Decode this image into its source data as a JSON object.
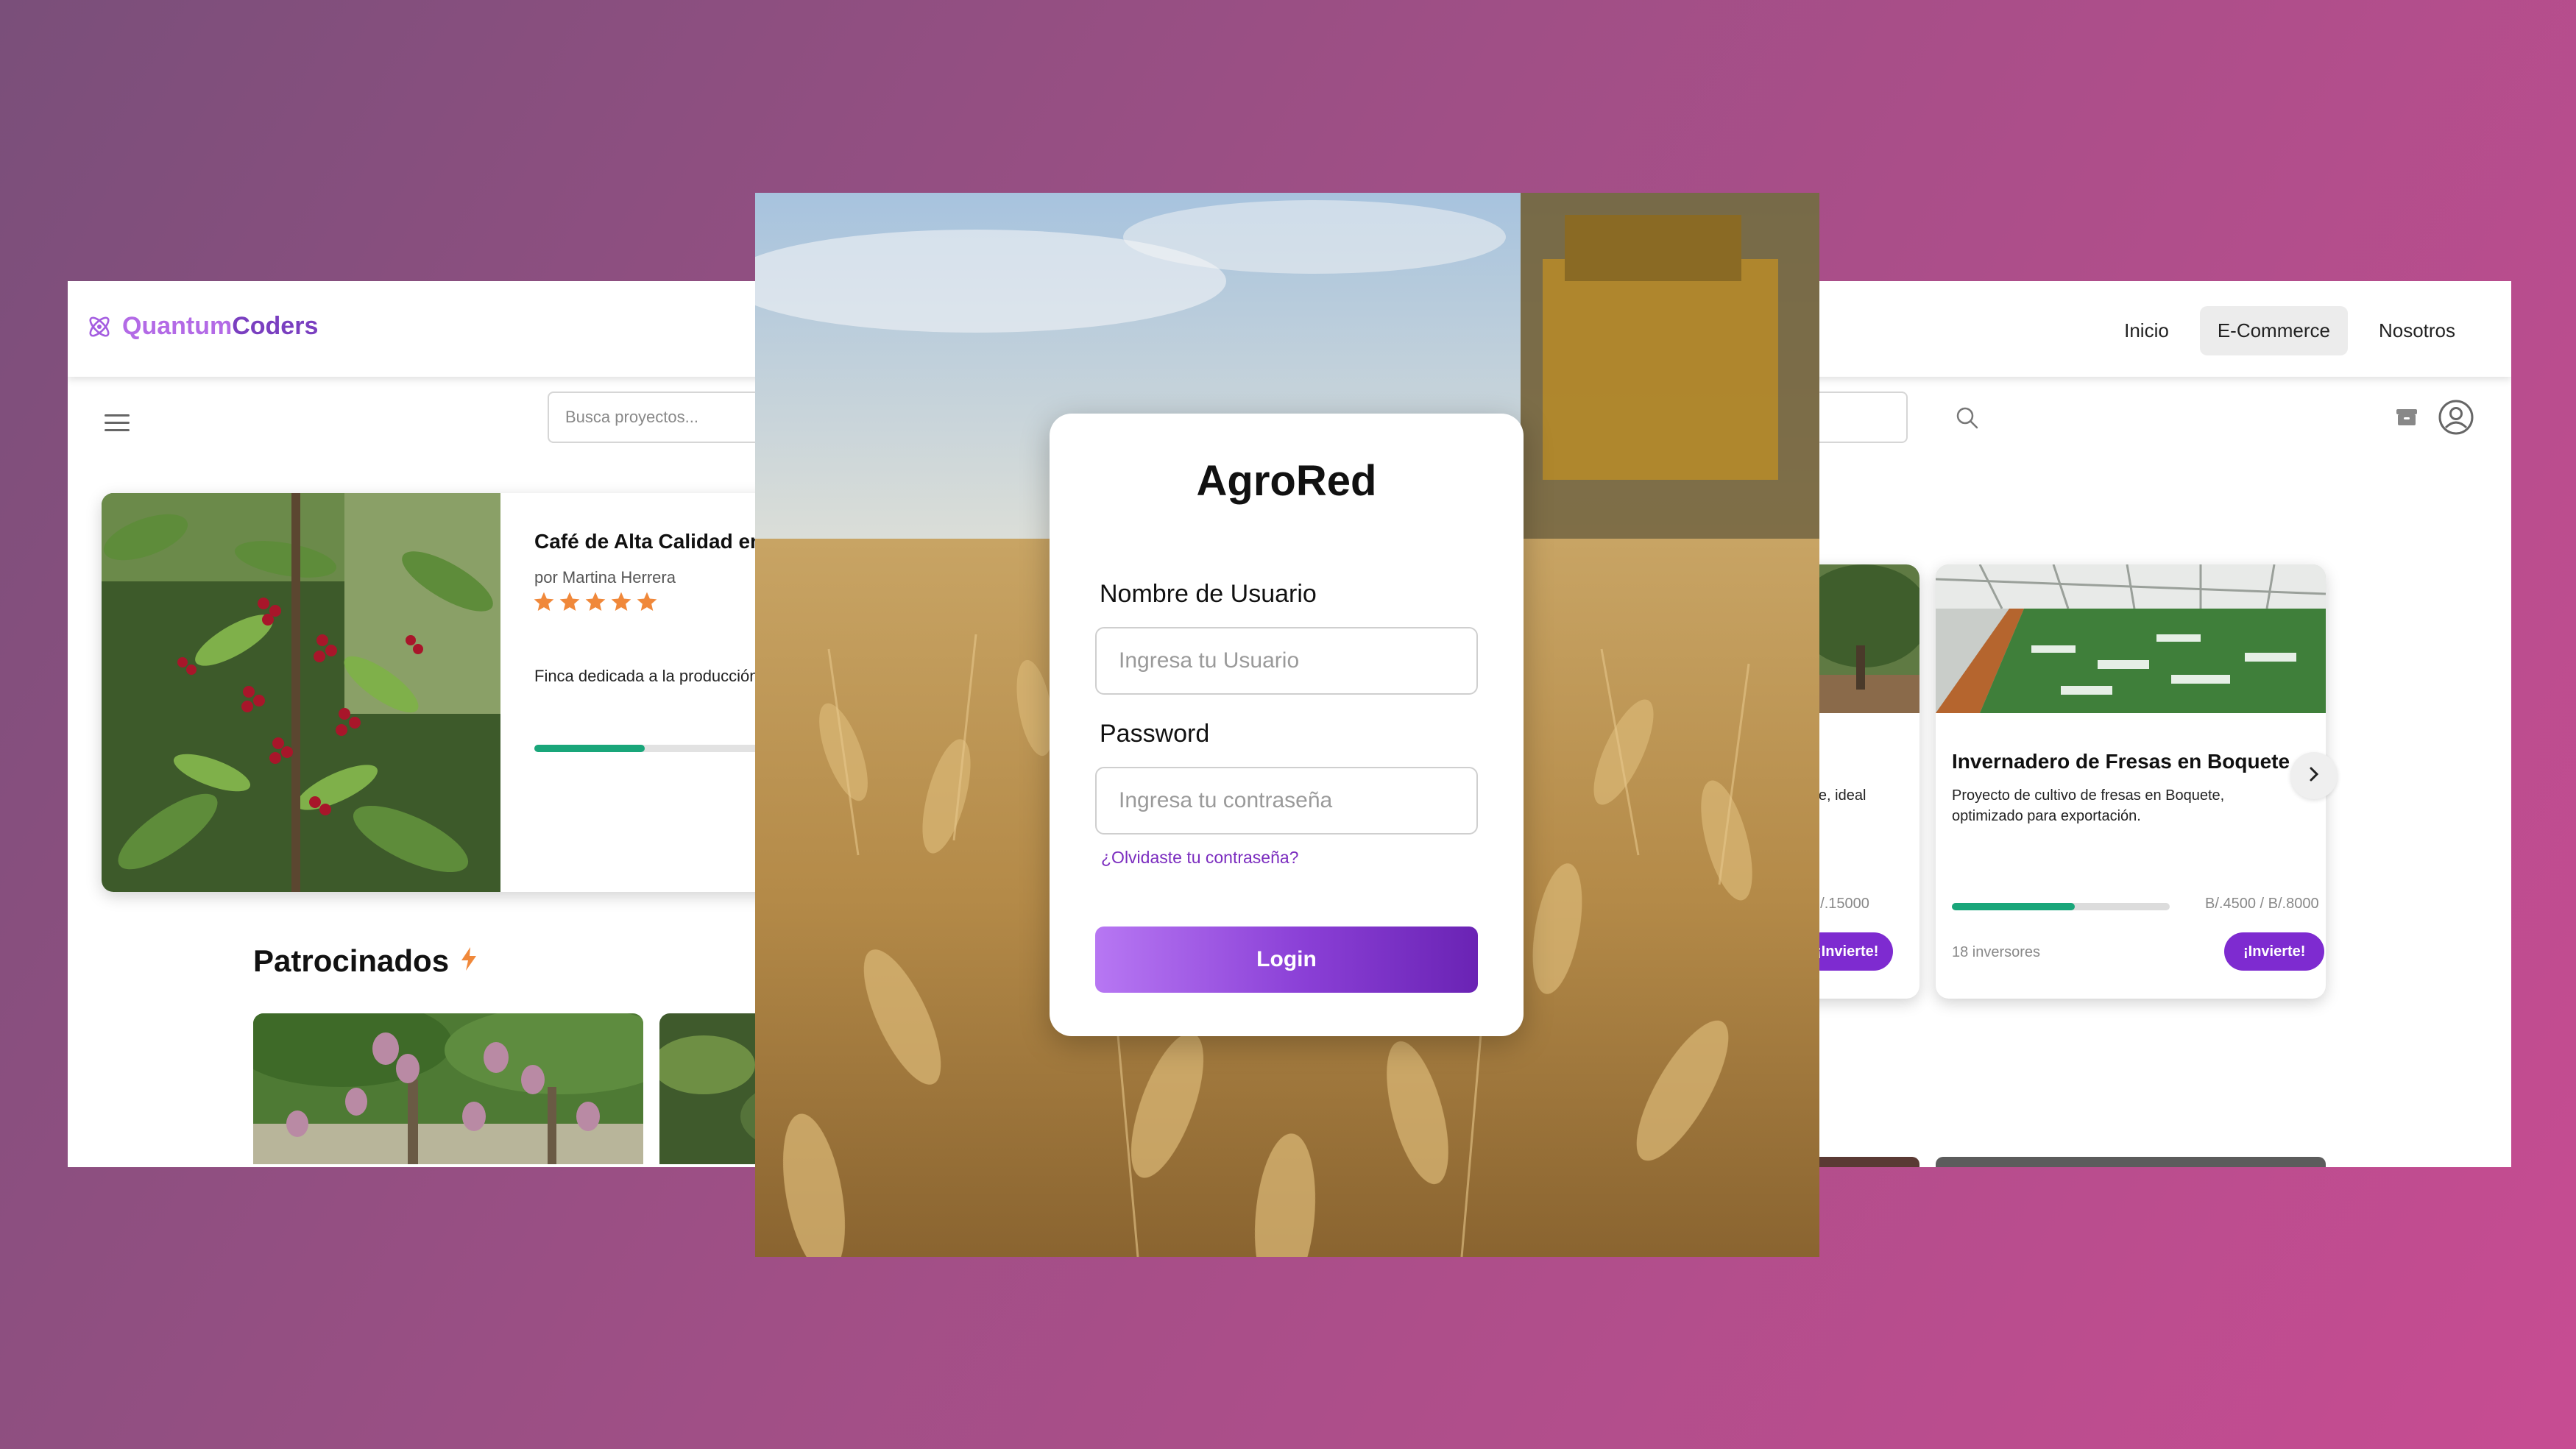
{
  "shop": {
    "brand": {
      "part1": "Quantum",
      "part2": "Coders"
    },
    "nav": {
      "home": "Inicio",
      "ecommerce": "E-Commerce",
      "about": "Nosotros"
    },
    "search": {
      "placeholder": "Busca proyectos..."
    },
    "featured": {
      "title": "Café de Alta Calidad en",
      "author": "por Martina Herrera",
      "rating": 5,
      "description": "Finca dedicada a la producción",
      "progress": 0.3
    },
    "sponsored": {
      "title": "Patrocinados"
    },
    "projects": [
      {
        "desc": "quete, ideal",
        "amount": "0 / B/.15000",
        "invest_label": "¡Invierte!"
      },
      {
        "title": "Invernadero de Fresas en Boquete",
        "desc": "Proyecto de cultivo de fresas en Boquete, optimizado para exportación.",
        "amount": "B/.4500 / B/.8000",
        "progress": 0.5625,
        "investors": "18 inversores",
        "invest_label": "¡Invierte!"
      }
    ],
    "colors": {
      "brand_light": "#b36ae6",
      "brand_dark": "#7a3fc0",
      "progress": "#19a67a",
      "button": "#7e2bd0",
      "star": "#f0883a"
    }
  },
  "login": {
    "title": "AgroRed",
    "username_label": "Nombre de Usuario",
    "username_placeholder": "Ingresa tu Usuario",
    "password_label": "Password",
    "password_placeholder": "Ingresa tu contraseña",
    "forgot": "¿Olvidaste tu contraseña?",
    "submit": "Login"
  }
}
